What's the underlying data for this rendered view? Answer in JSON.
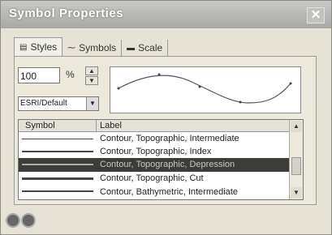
{
  "window": {
    "title": "Symbol Properties",
    "close_glyph": "✕"
  },
  "tabs": [
    {
      "label": "Styles",
      "icon": "styles-icon"
    },
    {
      "label": "Symbols",
      "icon": "line-symbol-icon"
    },
    {
      "label": "Scale",
      "icon": "scale-icon"
    }
  ],
  "size": {
    "value": "100",
    "unit": "%"
  },
  "style_select": {
    "value": "ESRI/Default"
  },
  "list": {
    "headers": {
      "symbol": "Symbol",
      "label": "Label"
    },
    "rows": [
      {
        "label": "Contour, Topographic, Intermediate",
        "thickness": 1,
        "selected": false
      },
      {
        "label": "Contour, Topographic, Index",
        "thickness": 2,
        "selected": false
      },
      {
        "label": "Contour, Topographic, Depression",
        "thickness": 2,
        "selected": true
      },
      {
        "label": "Contour, Topographic, Cut",
        "thickness": 3,
        "selected": false
      },
      {
        "label": "Contour, Bathymetric, Intermediate",
        "thickness": 2,
        "selected": false
      }
    ]
  }
}
